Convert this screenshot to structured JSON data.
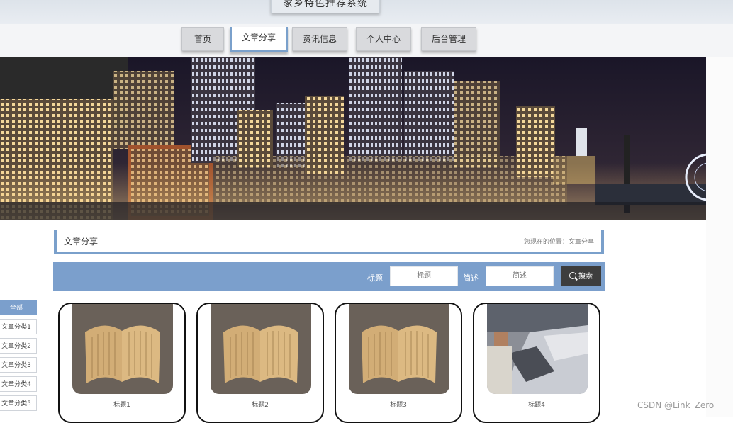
{
  "header": {
    "title": "家乡特色推荐系统"
  },
  "nav": {
    "items": [
      {
        "label": "首页",
        "active": false
      },
      {
        "label": "文章分享",
        "active": true
      },
      {
        "label": "资讯信息",
        "active": false
      },
      {
        "label": "个人中心",
        "active": false
      },
      {
        "label": "后台管理",
        "active": false
      }
    ]
  },
  "section": {
    "title": "文章分享",
    "breadcrumb": "您现在的位置：文章分享"
  },
  "search": {
    "title_label": "标题",
    "title_placeholder": "标题",
    "desc_label": "简述",
    "desc_placeholder": "简述",
    "button_label": "搜索"
  },
  "categories": [
    "全部",
    "文章分类1",
    "文章分类2",
    "文章分类3",
    "文章分类4",
    "文章分类5"
  ],
  "articles": [
    {
      "title": "标题1",
      "image": "book"
    },
    {
      "title": "标题2",
      "image": "book"
    },
    {
      "title": "标题3",
      "image": "book"
    },
    {
      "title": "标题4",
      "image": "street"
    }
  ],
  "watermark": "CSDN @Link_Zero",
  "colors": {
    "accent": "#7b9fcc",
    "button": "#3d3d3d"
  }
}
